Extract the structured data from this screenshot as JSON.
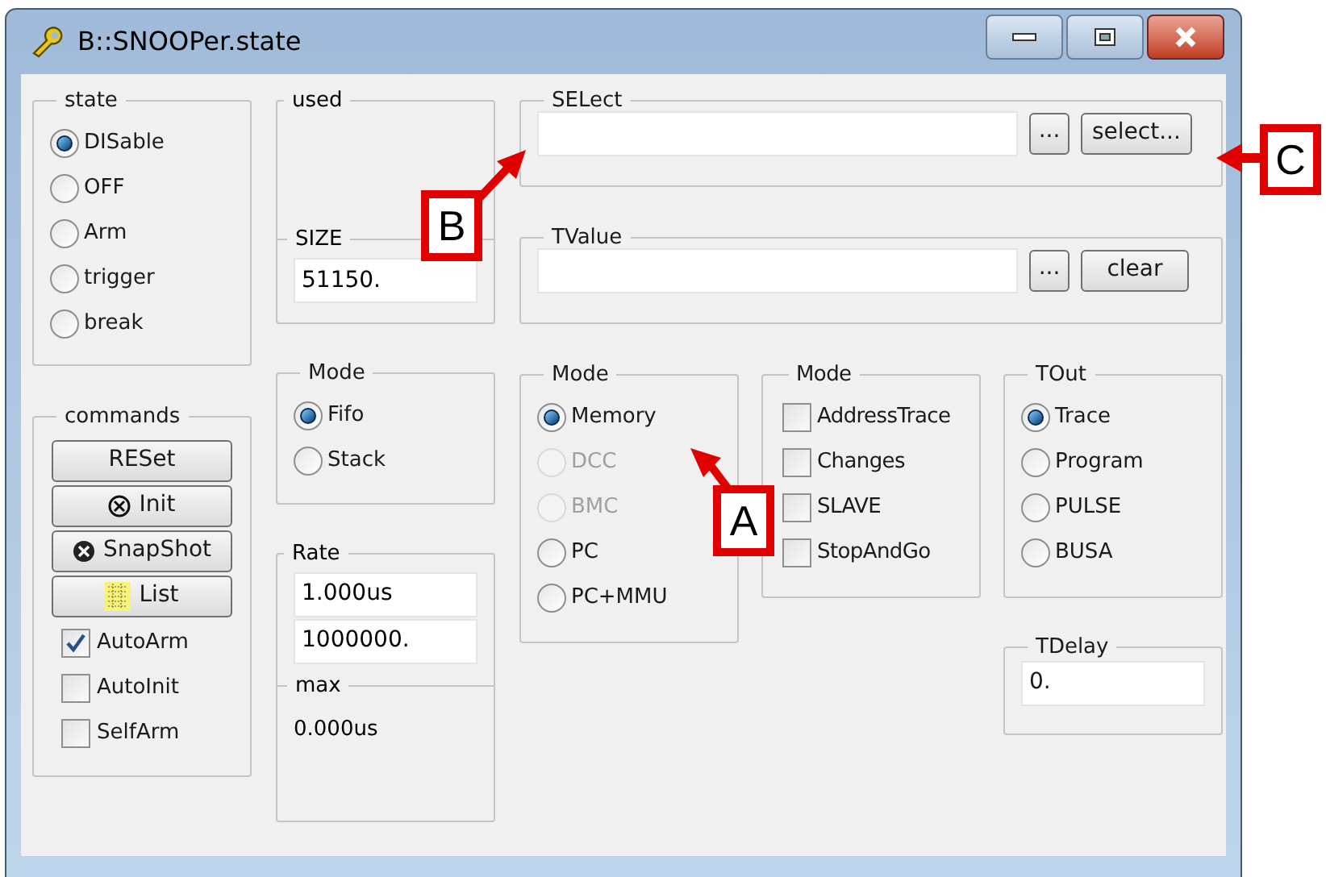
{
  "window": {
    "title": "B::SNOOPer.state"
  },
  "state": {
    "label": "state",
    "options": [
      {
        "label": "DISable",
        "selected": true
      },
      {
        "label": "OFF",
        "selected": false
      },
      {
        "label": "Arm",
        "selected": false
      },
      {
        "label": "trigger",
        "selected": false
      },
      {
        "label": "break",
        "selected": false
      }
    ]
  },
  "used": {
    "label": "used"
  },
  "size": {
    "label": "SIZE",
    "value": "51150."
  },
  "select": {
    "label": "SELect",
    "buttons": [
      "...",
      "select..."
    ]
  },
  "tvalue": {
    "label": "TValue",
    "buttons": [
      "...",
      "clear"
    ]
  },
  "commands": {
    "label": "commands",
    "buttons": [
      {
        "label": "RESet",
        "kind": "plain"
      },
      {
        "label": "Init",
        "kind": "init"
      },
      {
        "label": "SnapShot",
        "kind": "snapshot"
      },
      {
        "label": "List",
        "kind": "list"
      }
    ],
    "checkboxes": [
      {
        "label": "AutoArm",
        "checked": true
      },
      {
        "label": "AutoInit",
        "checked": false
      },
      {
        "label": "SelfArm",
        "checked": false
      }
    ]
  },
  "mode_buffer": {
    "label": "Mode",
    "options": [
      {
        "label": "Fifo",
        "selected": true
      },
      {
        "label": "Stack",
        "selected": false
      }
    ]
  },
  "rate": {
    "label": "Rate",
    "values": [
      "1.000us",
      "1000000."
    ],
    "max_label": "max",
    "max_value": "0.000us"
  },
  "mode_source": {
    "label": "Mode",
    "options": [
      {
        "label": "Memory",
        "selected": true,
        "disabled": false
      },
      {
        "label": "DCC",
        "selected": false,
        "disabled": true
      },
      {
        "label": "BMC",
        "selected": false,
        "disabled": true
      },
      {
        "label": "PC",
        "selected": false,
        "disabled": false
      },
      {
        "label": "PC+MMU",
        "selected": false,
        "disabled": false
      }
    ]
  },
  "mode_flags": {
    "label": "Mode",
    "options": [
      {
        "label": "AddressTrace",
        "checked": false
      },
      {
        "label": "Changes",
        "checked": false
      },
      {
        "label": "SLAVE",
        "checked": false
      },
      {
        "label": "StopAndGo",
        "checked": false
      }
    ]
  },
  "tout": {
    "label": "TOut",
    "options": [
      {
        "label": "Trace",
        "selected": true
      },
      {
        "label": "Program",
        "selected": false
      },
      {
        "label": "PULSE",
        "selected": false
      },
      {
        "label": "BUSA",
        "selected": false
      }
    ]
  },
  "tdelay": {
    "label": "TDelay",
    "value": "0."
  },
  "callouts": [
    {
      "label": "A"
    },
    {
      "label": "B"
    },
    {
      "label": "C"
    }
  ]
}
